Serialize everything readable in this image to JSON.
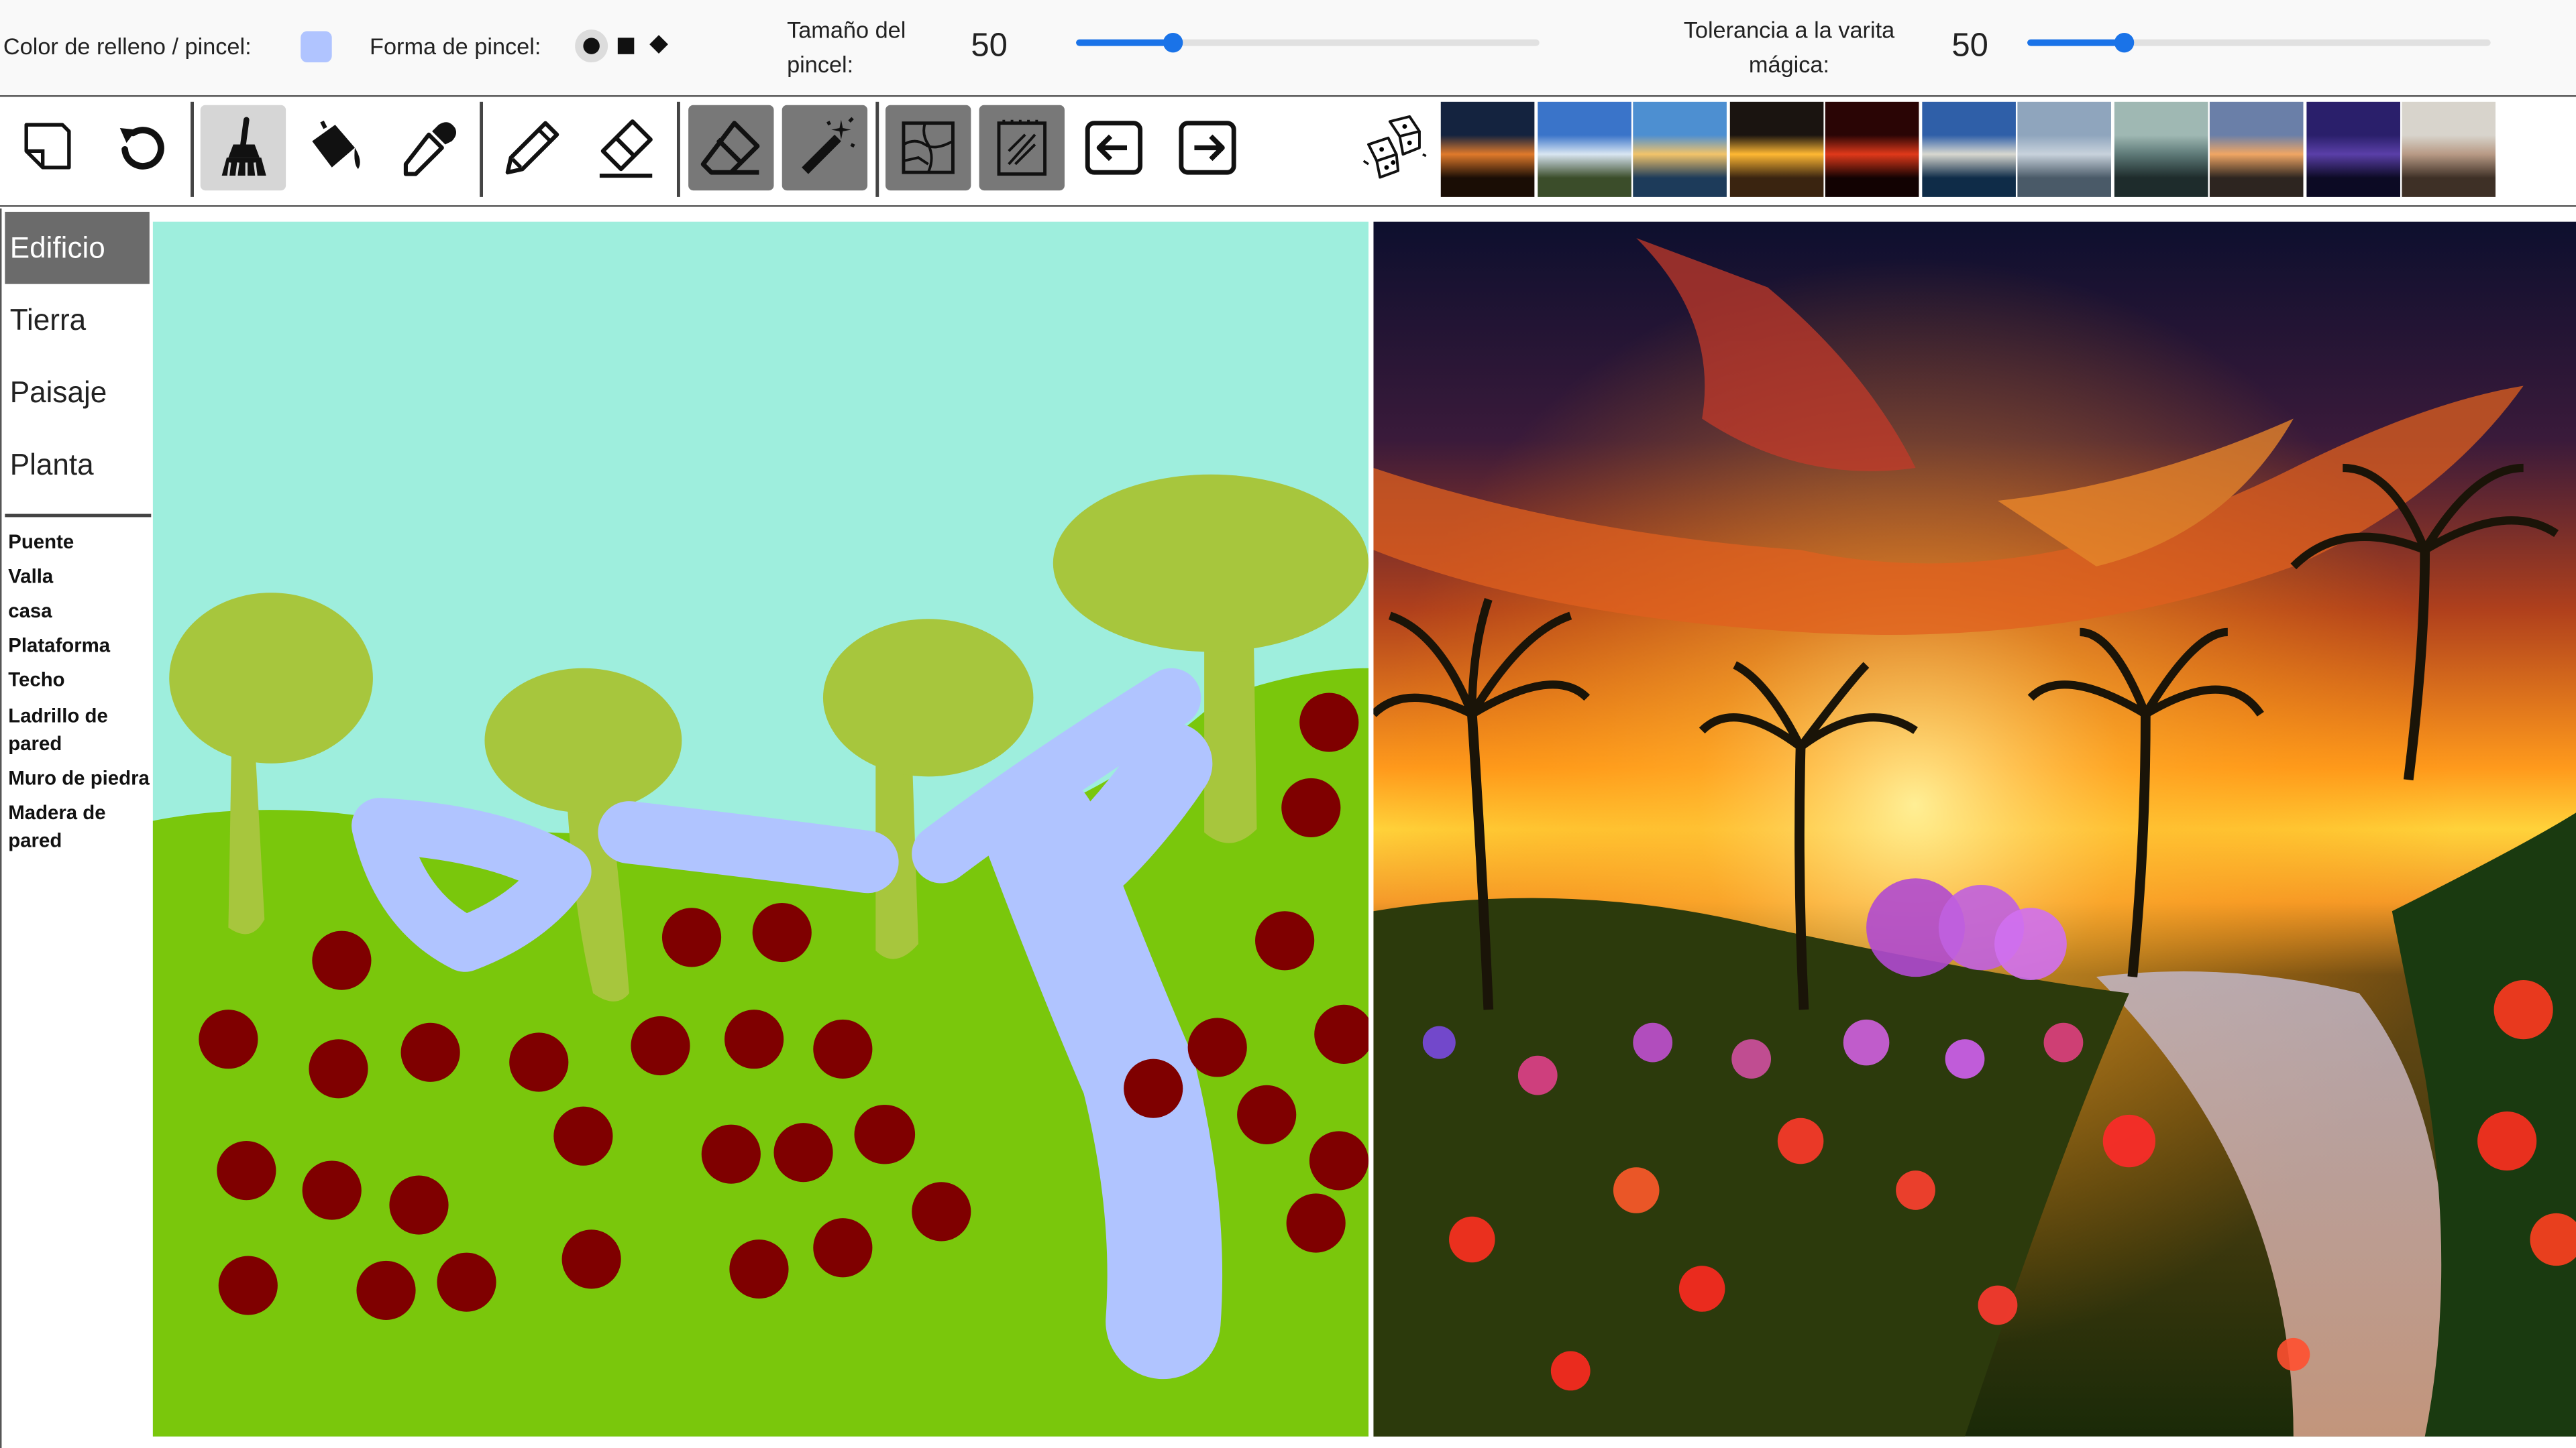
{
  "colors": {
    "brush": "#b0c4ff",
    "accent": "#1a73e8",
    "sky": "#9eeedd",
    "ground": "#7ac70c",
    "tree": "#a7c63d",
    "rock": "#7f0000"
  },
  "topbar": {
    "fill_color_label": "Color de relleno / pincel:",
    "brush_shape_label": "Forma de pincel:",
    "brush_shapes": [
      "circle",
      "square",
      "diamond"
    ],
    "brush_shape_selected": "circle",
    "brush_size_label_line1": "Tamaño del",
    "brush_size_label_line2": "pincel:",
    "brush_size_value": "50",
    "brush_size_fraction": 0.21,
    "tolerance_label_line1": "Tolerancia a la varita",
    "tolerance_label_line2": "mágica:",
    "tolerance_value": "50",
    "tolerance_fraction": 0.21
  },
  "toolbar": {
    "tools": [
      {
        "name": "new-canvas-icon",
        "state": "normal"
      },
      {
        "name": "undo-icon",
        "state": "normal"
      },
      {
        "name": "broom-icon",
        "state": "selected"
      },
      {
        "name": "paint-bucket-icon",
        "state": "normal"
      },
      {
        "name": "eyedropper-icon",
        "state": "normal"
      },
      {
        "name": "pencil-icon",
        "state": "normal"
      },
      {
        "name": "pen-eraser-icon",
        "state": "normal"
      },
      {
        "name": "eraser-icon",
        "state": "active-dark"
      },
      {
        "name": "magic-wand-icon",
        "state": "active-dark"
      },
      {
        "name": "segment-map-icon",
        "state": "active-dark"
      },
      {
        "name": "sketch-map-icon",
        "state": "active-dark"
      },
      {
        "name": "arrow-left-icon",
        "state": "normal"
      },
      {
        "name": "arrow-right-icon",
        "state": "normal"
      },
      {
        "name": "dice-icon",
        "state": "normal"
      }
    ],
    "style_thumbnails": [
      {
        "name": "sunset-silhouette",
        "top": "#14233f",
        "mid": "#e07a2b",
        "bottom": "#1a0d05"
      },
      {
        "name": "road-blue-sky",
        "top": "#3a74c9",
        "mid": "#d9e6f2",
        "bottom": "#3b4d2a"
      },
      {
        "name": "lake-sunrise",
        "top": "#4d8fd1",
        "mid": "#f2c46a",
        "bottom": "#1d3b5a"
      },
      {
        "name": "ocean-sunset",
        "top": "#1a1410",
        "mid": "#ffb833",
        "bottom": "#3a2410"
      },
      {
        "name": "red-sky",
        "top": "#2a0505",
        "mid": "#e0391a",
        "bottom": "#120202"
      },
      {
        "name": "mountain-lake",
        "top": "#2f5fa8",
        "mid": "#d8d8d0",
        "bottom": "#0f2c48"
      },
      {
        "name": "grey-sea",
        "top": "#8fa5bd",
        "mid": "#c8d2dc",
        "bottom": "#4a5a68"
      },
      {
        "name": "beach-walker",
        "top": "#9fb8b3",
        "mid": "#5e7a78",
        "bottom": "#1e2c2c"
      },
      {
        "name": "cloudy-sunset",
        "top": "#6a7fa8",
        "mid": "#f0a664",
        "bottom": "#2d2520"
      },
      {
        "name": "purple-dusk",
        "top": "#2a1f6b",
        "mid": "#5a3fa8",
        "bottom": "#0c0a24"
      },
      {
        "name": "pale-shore",
        "top": "#d8d4cc",
        "mid": "#b89a85",
        "bottom": "#3e3026"
      }
    ]
  },
  "sidebar": {
    "categories": [
      "Edificio",
      "Tierra",
      "Paisaje",
      "Planta"
    ],
    "active_category": "Edificio",
    "labels": [
      {
        "line1": "Puente",
        "line2": ""
      },
      {
        "line1": "Valla",
        "line2": ""
      },
      {
        "line1": "casa",
        "line2": ""
      },
      {
        "line1": "Plataforma",
        "line2": ""
      },
      {
        "line1": "Techo",
        "line2": ""
      },
      {
        "line1": "Ladrillo de",
        "line2": "pared"
      },
      {
        "line1": "Muro de piedra",
        "line2": ""
      },
      {
        "line1": "Madera de",
        "line2": "pared"
      }
    ]
  }
}
